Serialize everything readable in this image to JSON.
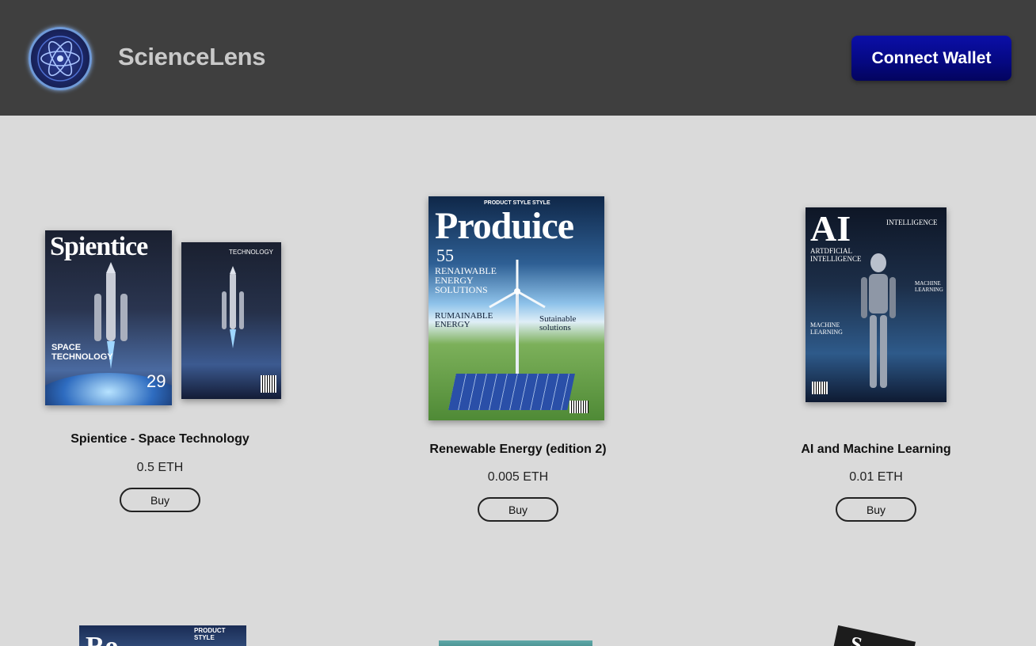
{
  "header": {
    "brand": "ScienceLens",
    "connect_label": "Connect Wallet",
    "logo_icon": "atom-icon"
  },
  "products": [
    {
      "title": "Spientice - Space Technology",
      "price": "0.5 ETH",
      "buy_label": "Buy",
      "cover_masthead": "Spientice",
      "cover_lines": [
        "SPACE TECHNOLOGY",
        "29",
        "TECHNOLOGY"
      ]
    },
    {
      "title": "Renewable Energy (edition 2)",
      "price": "0.005 ETH",
      "buy_label": "Buy",
      "cover_masthead": "Produice",
      "cover_kicker": "PRODUCT STYLE STYLE",
      "cover_lines": [
        "55",
        "RENAIWABLE ENERGY SOLUTIONS",
        "RUMAINABLE ENERGY",
        "Sutainable solutions"
      ]
    },
    {
      "title": "AI and Machine Learning",
      "price": "0.01 ETH",
      "buy_label": "Buy",
      "cover_masthead": "AI",
      "cover_lines": [
        "INTELLIGENCE",
        "ARTDFICIAL INTELLIGENCE",
        "MACHINE LEARNING",
        "MACHINE LEARNING"
      ]
    }
  ],
  "second_row": [
    {
      "cover_kicker": "PRODUCT STYLE",
      "cover_masthead": "Ro"
    },
    {},
    {
      "cover_masthead": "S"
    }
  ],
  "colors": {
    "header_bg": "#3f3f3f",
    "page_bg": "#dadada",
    "connect_button": "#050880"
  }
}
